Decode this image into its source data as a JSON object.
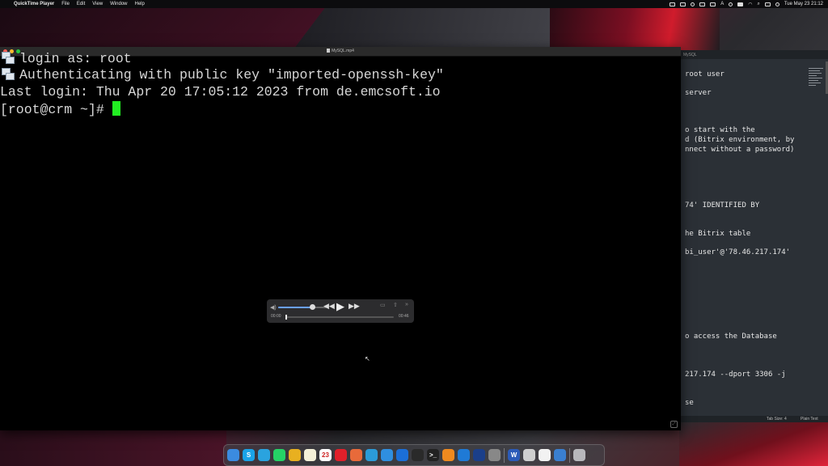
{
  "menubar": {
    "apple": "",
    "app_name": "QuickTime Player",
    "menus": [
      "File",
      "Edit",
      "View",
      "Window",
      "Help"
    ],
    "clock": "Tue May 23  21:12",
    "input_source": "A"
  },
  "qt_window": {
    "title": "MySQL.mp4"
  },
  "terminal": {
    "lines": [
      "login as: root",
      "Authenticating with public key \"imported-openssh-key\"",
      "Last login: Thu Apr 20 17:05:12 2023 from de.emcsoft.io",
      "[root@crm ~]#"
    ]
  },
  "player": {
    "time_elapsed": "00:00",
    "time_remaining": "00:46",
    "volume_level": 0.7,
    "progress": 0.0
  },
  "editor": {
    "title": "MySQL",
    "lines": [
      "root user",
      "server",
      "o start with the",
      "d (Bitrix environment, by",
      "nnect without a password)",
      "74' IDENTIFIED BY",
      "he Bitrix table",
      "bi_user'@'78.46.217.174'",
      "o access the Database",
      "217.174 --dport 3306 -j",
      "se"
    ],
    "status_tab": "Tab Size: 4",
    "status_mode": "Plain Text"
  },
  "dock": {
    "items": [
      {
        "name": "finder-icon",
        "color": "#3b8be0",
        "glyph": ""
      },
      {
        "name": "skype-icon",
        "color": "#1aa3e8",
        "glyph": "S"
      },
      {
        "name": "telegram-icon",
        "color": "#2aa3df",
        "glyph": ""
      },
      {
        "name": "whatsapp-icon",
        "color": "#25d366",
        "glyph": ""
      },
      {
        "name": "chrome-icon",
        "color": "#e8b020",
        "glyph": ""
      },
      {
        "name": "notes-icon",
        "color": "#f4f0d8",
        "glyph": ""
      },
      {
        "name": "calendar-icon",
        "color": "#ffffff",
        "glyph": "23"
      },
      {
        "name": "opera-icon",
        "color": "#e0202a",
        "glyph": ""
      },
      {
        "name": "photo-app-icon",
        "color": "#e86a3a",
        "glyph": ""
      },
      {
        "name": "remote-app-icon",
        "color": "#2b9bd8",
        "glyph": ""
      },
      {
        "name": "safari-icon",
        "color": "#2f8fe0",
        "glyph": ""
      },
      {
        "name": "one-password-icon",
        "color": "#1b6fd8",
        "glyph": ""
      },
      {
        "name": "activity-monitor-icon",
        "color": "#2a2a2a",
        "glyph": ""
      },
      {
        "name": "terminal-icon",
        "color": "#222222",
        "glyph": ">_"
      },
      {
        "name": "sublime-icon",
        "color": "#ef8a1f",
        "glyph": ""
      },
      {
        "name": "vscode-icon",
        "color": "#1f7ad6",
        "glyph": ""
      },
      {
        "name": "proxy-app-icon",
        "color": "#1b3f8a",
        "glyph": ""
      },
      {
        "name": "launchpad-icon",
        "color": "#888888",
        "glyph": ""
      },
      {
        "name": "word-icon",
        "color": "#2b5bb8",
        "glyph": "W"
      },
      {
        "name": "keychain-icon",
        "color": "#cfcfcf",
        "glyph": ""
      },
      {
        "name": "textedit-icon",
        "color": "#f2f2f2",
        "glyph": ""
      },
      {
        "name": "quicktime-icon",
        "color": "#3a7fd0",
        "glyph": ""
      },
      {
        "name": "trash-icon",
        "color": "#b8b8bc",
        "glyph": ""
      }
    ]
  }
}
